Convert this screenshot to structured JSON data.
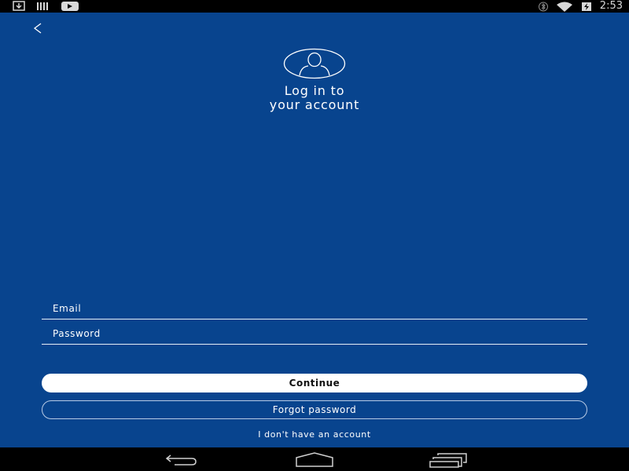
{
  "status_bar": {
    "time": "2:53",
    "left_icons": [
      "download-icon",
      "barcode-icon",
      "youtube-icon"
    ],
    "right_icons": [
      "bluetooth-icon",
      "wifi-icon",
      "battery-charging-icon"
    ]
  },
  "header": {
    "back_label": "<",
    "title_line1": "Log in to",
    "title_line2": "your account",
    "avatar_icon": "user-avatar-icon"
  },
  "form": {
    "email_placeholder": "Email",
    "email_value": "",
    "password_placeholder": "Password",
    "password_value": "",
    "continue_label": "Continue",
    "forgot_label": "Forgot password",
    "no_account_label": "I don't have an account"
  },
  "nav_bar": {
    "buttons": [
      "back-icon",
      "home-icon",
      "recents-icon"
    ]
  },
  "colors": {
    "background": "#08448e",
    "button_primary_bg": "#ffffff",
    "button_primary_text": "#111111",
    "text": "#ffffff"
  }
}
